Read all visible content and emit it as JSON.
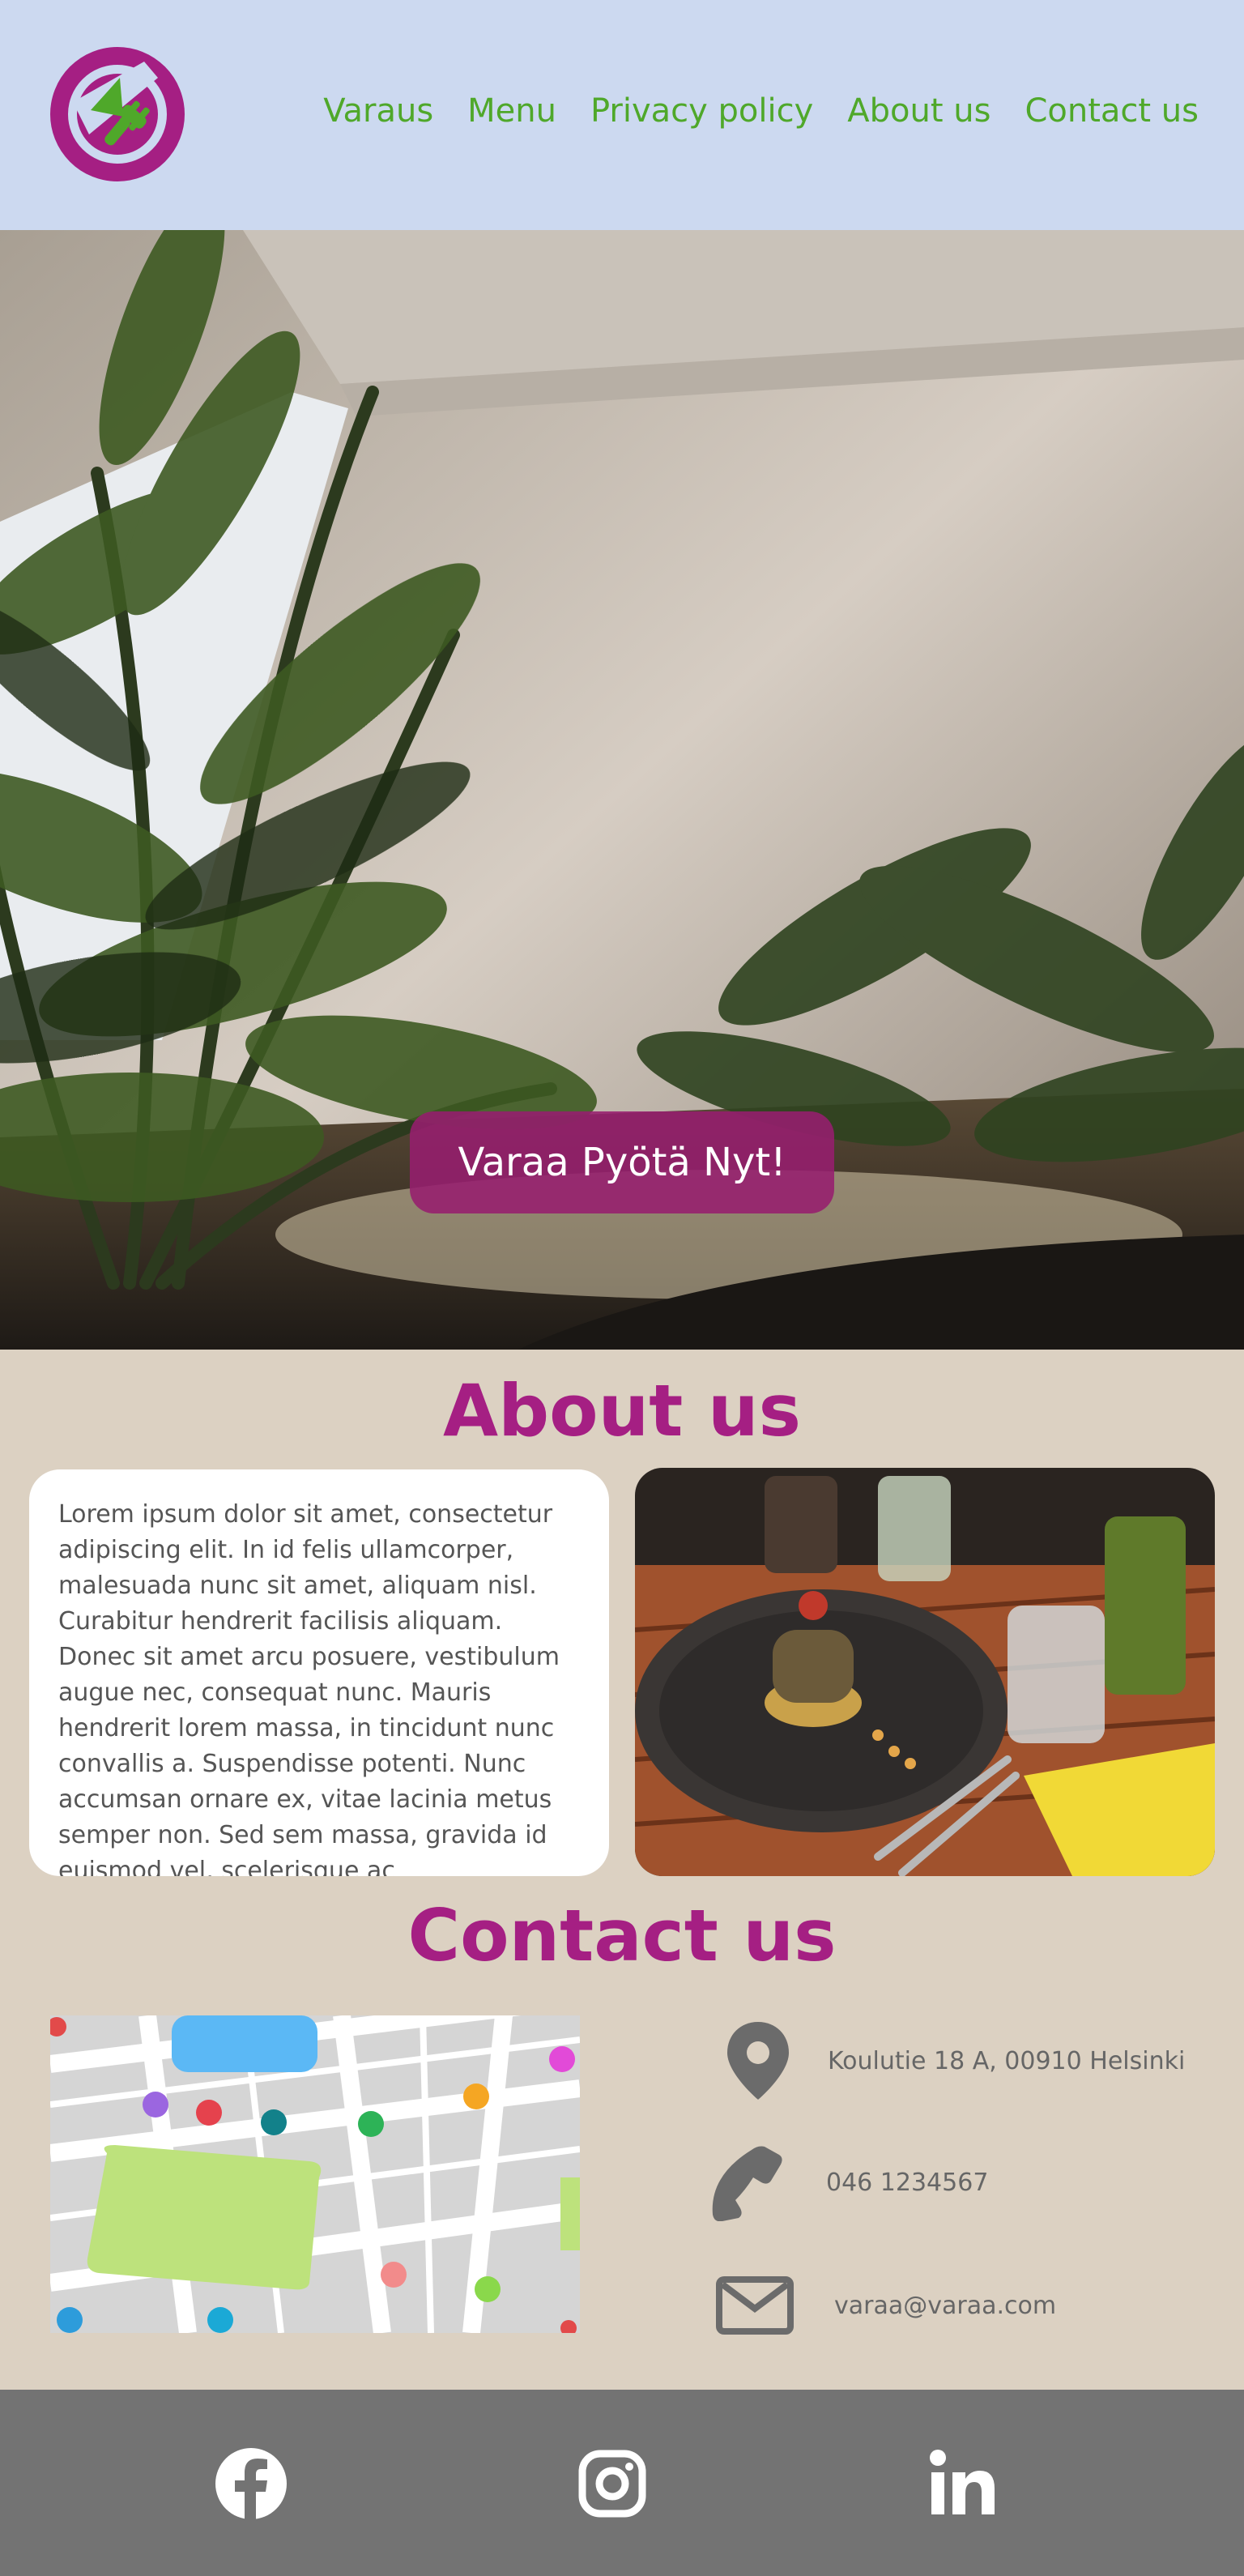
{
  "header": {
    "logo": "restaurant-logo",
    "nav": [
      {
        "label": "Varaus"
      },
      {
        "label": "Menu"
      },
      {
        "label": "Privacy policy"
      },
      {
        "label": "About us"
      },
      {
        "label": "Contact us"
      }
    ]
  },
  "hero": {
    "image": "restaurant interior with palm plants",
    "cta_label": "Varaa Pyötä Nyt!"
  },
  "about": {
    "title": "About us",
    "text": "Lorem ipsum dolor sit amet, consectetur adipiscing elit. In id felis ullamcorper, malesuada nunc sit amet, aliquam nisl. Curabitur hendrerit facilisis aliquam. Donec sit amet arcu posuere, vestibulum augue nec, consequat nunc. Mauris hendrerit lorem massa, in tincidunt nunc convallis a. Suspendisse potenti. Nunc accumsan ornare ex, vitae lacinia metus semper non. Sed sem massa, gravida id euismod vel, scelerisque ac",
    "image": "plated dish with drinks on wooden table"
  },
  "contact": {
    "title": "Contact us",
    "address": "Koulutie 18 A, 00910 Helsinki",
    "phone": "046 1234567",
    "email": "varaa@varaa.com",
    "map": "city map illustration"
  },
  "footer": {
    "socials": [
      "facebook-icon",
      "instagram-icon",
      "linkedin-icon"
    ]
  },
  "colors": {
    "header_bg": "#ccd9f0",
    "nav_link": "#4fa82a",
    "accent": "#a51f83",
    "page_bg": "#dcd1c2",
    "footer_bg": "#737373"
  }
}
